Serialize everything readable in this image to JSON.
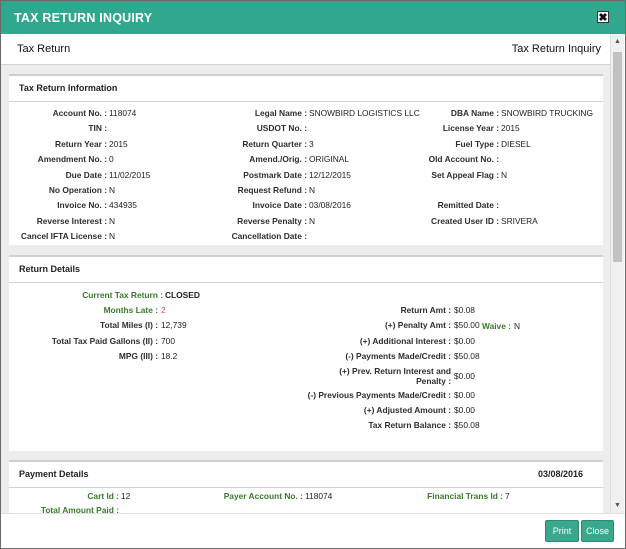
{
  "dialog": {
    "title": "TAX RETURN INQUIRY",
    "close_glyph": "✖"
  },
  "breadcrumb": {
    "left": "Tax Return",
    "right": "Tax Return Inquiry"
  },
  "info": {
    "title": "Tax Return Information",
    "col1": [
      {
        "label": "Account No. :",
        "value": "118074"
      },
      {
        "label": "TIN :",
        "value": ""
      },
      {
        "label": "Return Year :",
        "value": "2015"
      },
      {
        "label": "Amendment No. :",
        "value": "0"
      },
      {
        "label": "Due Date :",
        "value": "11/02/2015"
      },
      {
        "label": "No Operation :",
        "value": "N"
      },
      {
        "label": "Invoice No. :",
        "value": "434935"
      },
      {
        "label": "Reverse Interest :",
        "value": "N"
      },
      {
        "label": "Cancel IFTA License :",
        "value": "N"
      }
    ],
    "col2": [
      {
        "label": "Legal Name :",
        "value": "SNOWBIRD LOGISTICS LLC"
      },
      {
        "label": "USDOT No. :",
        "value": ""
      },
      {
        "label": "Return Quarter :",
        "value": "3"
      },
      {
        "label": "Amend./Orig. :",
        "value": "ORIGINAL"
      },
      {
        "label": "Postmark Date :",
        "value": "12/12/2015"
      },
      {
        "label": "Request Refund :",
        "value": "N"
      },
      {
        "label": "Invoice Date :",
        "value": "03/08/2016"
      },
      {
        "label": "Reverse Penalty :",
        "value": "N"
      },
      {
        "label": "Cancellation Date :",
        "value": ""
      }
    ],
    "col3": [
      {
        "label": "DBA Name :",
        "value": "SNOWBIRD TRUCKING"
      },
      {
        "label": "License Year :",
        "value": "2015"
      },
      {
        "label": "Fuel Type :",
        "value": "DIESEL"
      },
      {
        "label": "Old Account No. :",
        "value": ""
      },
      {
        "label": "Set Appeal Flag :",
        "value": "N"
      },
      {
        "label": "",
        "value": ""
      },
      {
        "label": "Remitted Date :",
        "value": ""
      },
      {
        "label": "Created User ID :",
        "value": "SRIVERA"
      }
    ]
  },
  "returns": {
    "title": "Return Details",
    "current_label": "Current Tax Return :",
    "current_value": "CLOSED",
    "left": [
      {
        "label": "Months Late :",
        "value": "2",
        "red": true
      },
      {
        "label": "Total Miles (I) :",
        "value": "12,739"
      },
      {
        "label": "Total Tax Paid Gallons (II) :",
        "value": "700"
      },
      {
        "label": "MPG (III) :",
        "value": "18.2"
      }
    ],
    "right": [
      {
        "label": "Return Amt :",
        "value": "$0.08"
      },
      {
        "label": "(+) Penalty Amt :",
        "value": "$50.00"
      },
      {
        "label": "(+) Additional Interest :",
        "value": "$0.00"
      },
      {
        "label": "(-) Payments Made/Credit :",
        "value": "$50.08"
      },
      {
        "label": "(+) Prev. Return Interest and",
        "label2": "Penalty :",
        "value": "$0.00"
      },
      {
        "label": "(-) Previous Payments Made/Credit :",
        "value": "$0.00"
      },
      {
        "label": "(+) Adjusted Amount :",
        "value": "$0.00"
      },
      {
        "label": "Tax Return Balance :",
        "value": "$50.08"
      }
    ],
    "waive_label": "Waive :",
    "waive_value": "N"
  },
  "payment": {
    "title": "Payment Details",
    "date": "03/08/2016",
    "cart_label": "Cart Id :",
    "cart_value": "12",
    "payer_label": "Payer Account No. :",
    "payer_value": "118074",
    "fin_label": "Financial Trans Id :",
    "fin_value": "7",
    "total_label": "Total Amount Paid :"
  },
  "footer": {
    "print_label": "Print",
    "close_label": "Close"
  },
  "colors": {
    "accent": "#2fa88e",
    "label_green": "#3a7a2a",
    "late_red": "#d9534f"
  }
}
